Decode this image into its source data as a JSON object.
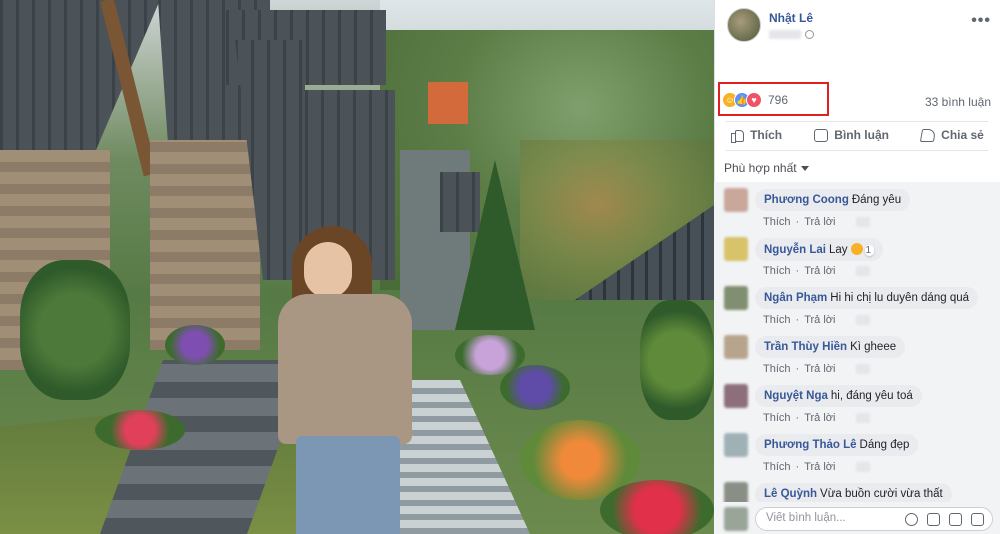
{
  "post": {
    "author": "Nhật Lê",
    "icons": {
      "privacy": "globe-icon",
      "menu": "more-options-icon"
    }
  },
  "reactions": {
    "types": [
      "haha",
      "like",
      "love"
    ],
    "count": "796",
    "comments_count": "33 bình luận"
  },
  "actions": {
    "like_label": "Thích",
    "comment_label": "Bình luận",
    "share_label": "Chia sẻ"
  },
  "sort": {
    "label": "Phù hợp nhất"
  },
  "comment_action_labels": {
    "like": "Thích",
    "reply": "Trả lời"
  },
  "comments": [
    {
      "name": "Phương Coong",
      "text": "Đáng yêu",
      "avatar_color": "#c9a79b"
    },
    {
      "name": "Nguyễn Lai",
      "text": "Lay",
      "reaction_count": "1",
      "avatar_color": "#d7c36a"
    },
    {
      "name": "Ngân Phạm",
      "text": "Hi hi chị lu duyên dáng quá",
      "avatar_color": "#7f8f6f"
    },
    {
      "name": "Trần Thùy Hiền",
      "text": "Kì gheee",
      "avatar_color": "#b6a58c"
    },
    {
      "name": "Nguyệt Nga",
      "text": "hi, đáng yêu toá",
      "avatar_color": "#8c6f7a"
    },
    {
      "name": "Phương Thảo Lê",
      "text": "Dáng đẹp",
      "avatar_color": "#9fb1b5"
    },
    {
      "name": "Lê Quỳnh",
      "text": "Vừa buồn cười vừa thất",
      "avatar_color": "#8a8f86"
    }
  ],
  "composer": {
    "placeholder": "Viết bình luận..."
  }
}
